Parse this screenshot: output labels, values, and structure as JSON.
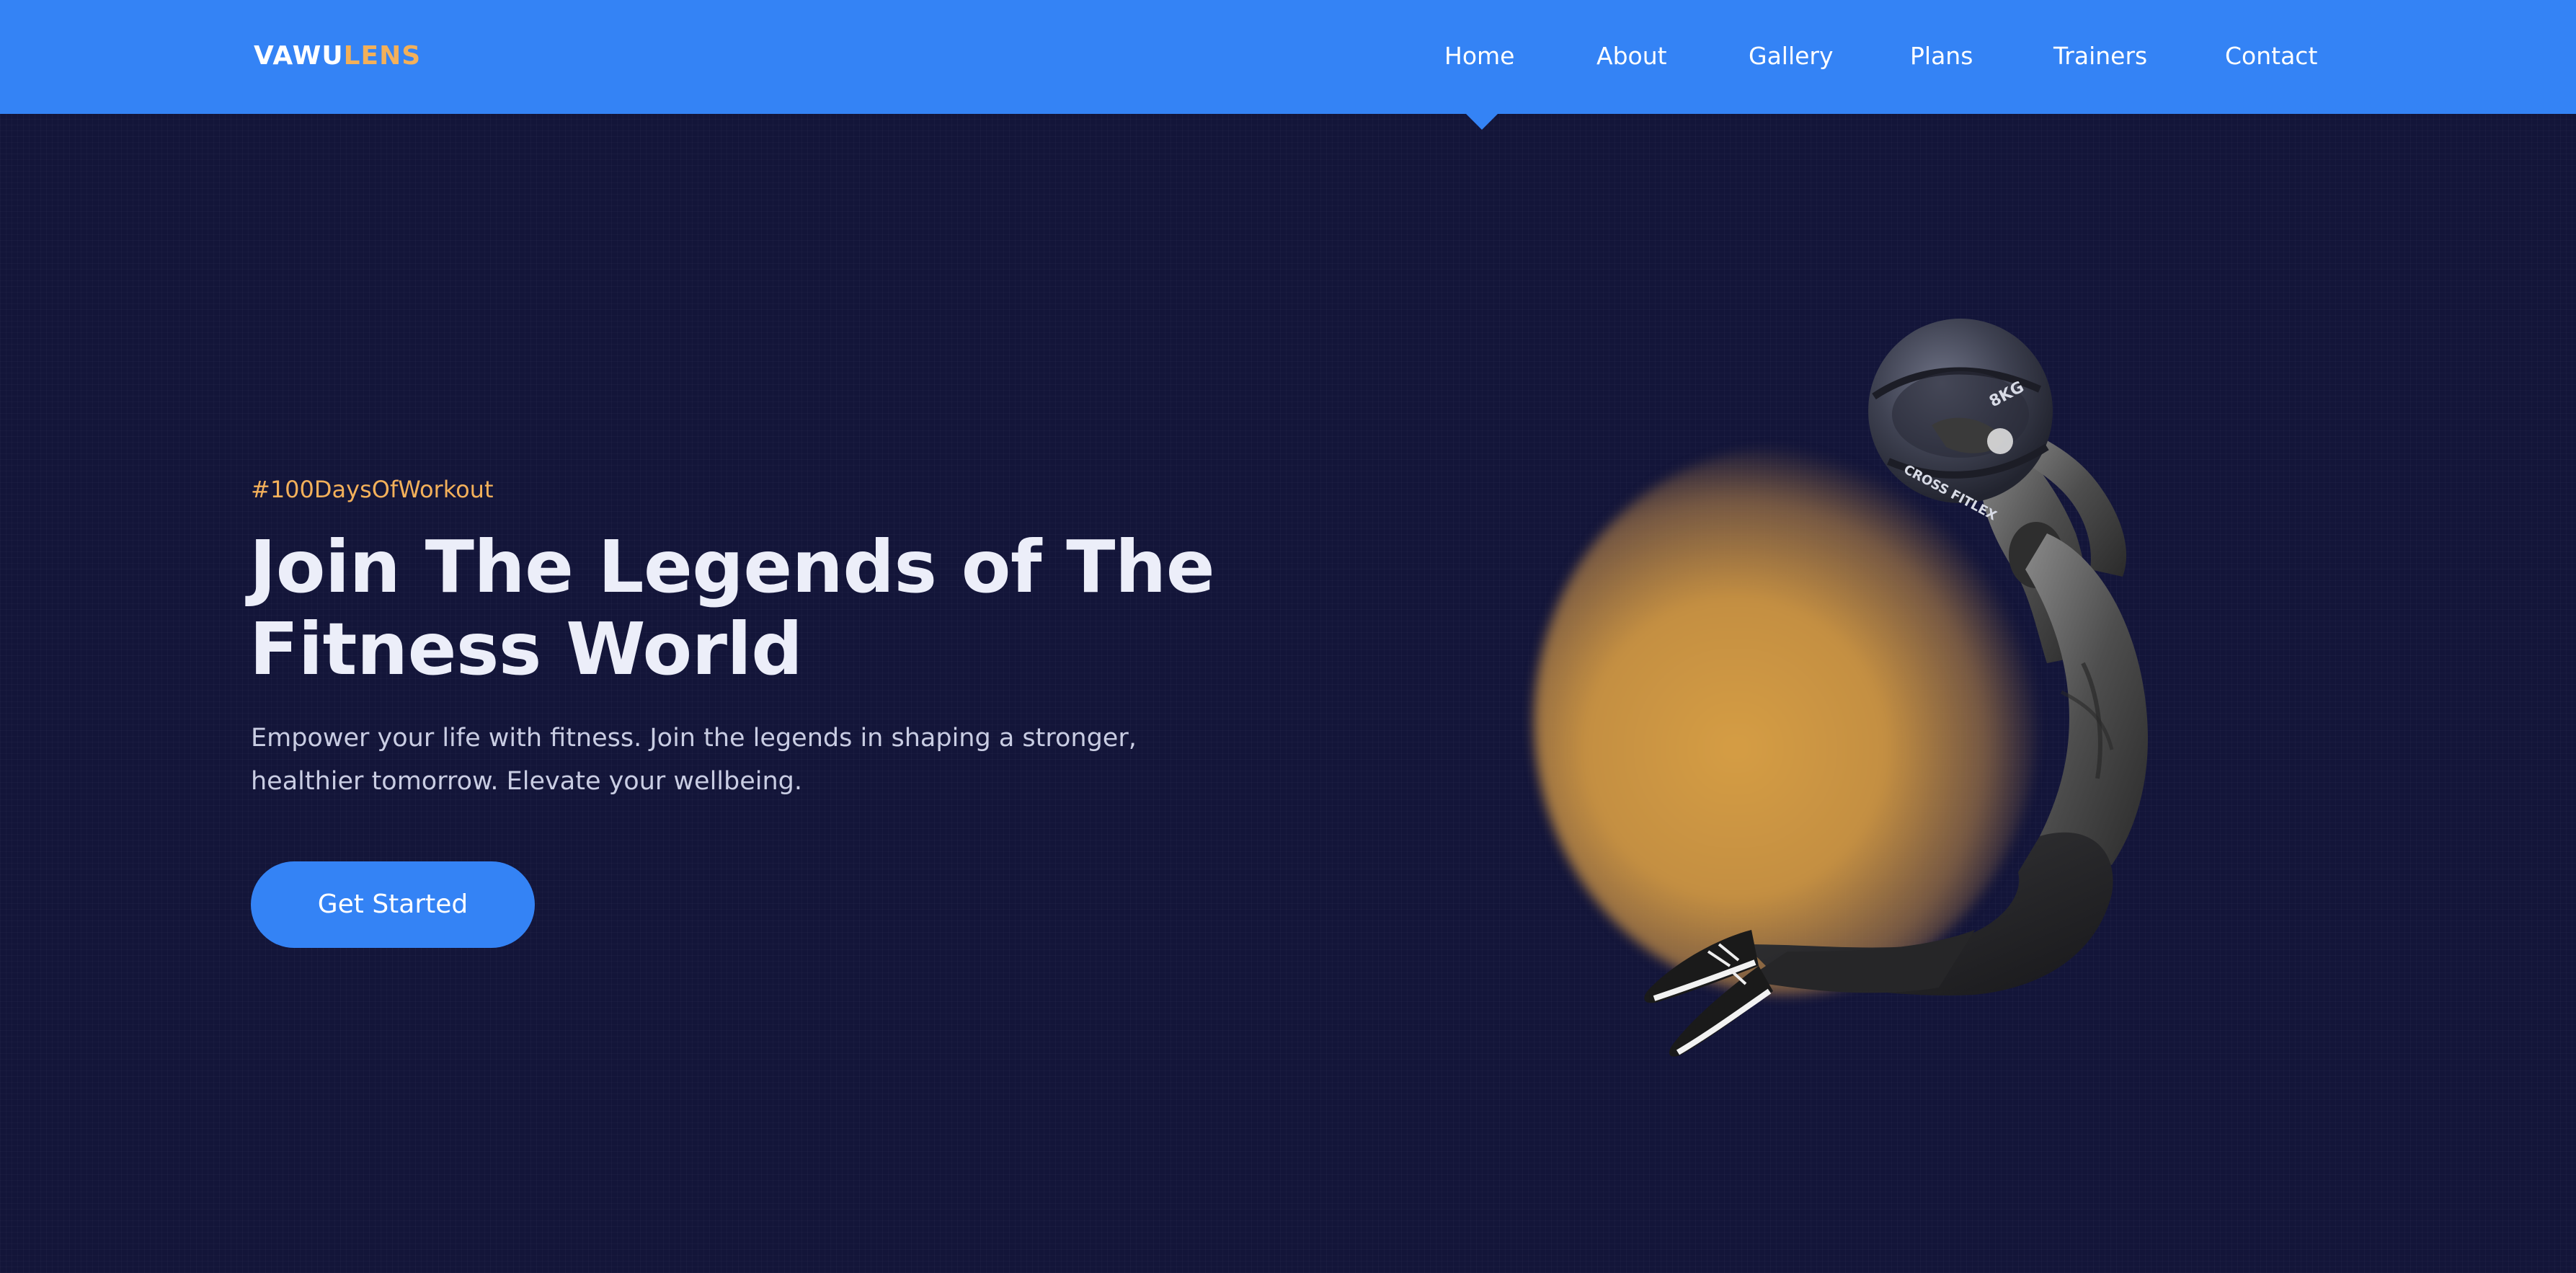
{
  "brand": {
    "part1": "VAWU",
    "part2": "LENS"
  },
  "nav": {
    "items": [
      "Home",
      "About",
      "Gallery",
      "Plans",
      "Trainers",
      "Contact"
    ],
    "active": "Home"
  },
  "hero": {
    "tagline": "#100DaysOfWorkout",
    "headline_line1": "Join The Legends of The",
    "headline_line2": "Fitness World",
    "description_line1": "Empower your life with fitness. Join the legends in shaping a stronger,",
    "description_line2": "healthier tomorrow. Elevate your wellbeing.",
    "cta_label": "Get Started"
  },
  "illustration": {
    "ball_print": "CROSS FITLEX",
    "ball_weight": "8KG"
  },
  "colors": {
    "header": "#3483f5",
    "background": "#131539",
    "accent": "#f3b05a",
    "headline": "#eceef9",
    "body_text": "#c9cde3"
  },
  "icons": {
    "nav_active_indicator": "caret-down-pointer"
  }
}
